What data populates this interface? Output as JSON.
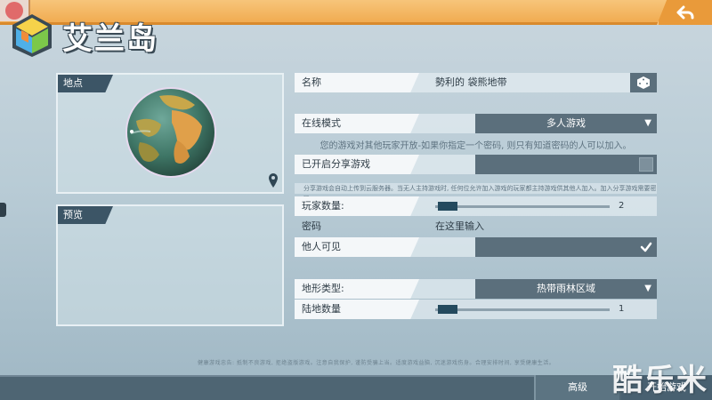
{
  "game": {
    "title": "艾兰岛"
  },
  "panels": {
    "location_label": "地点",
    "preview_label": "预览"
  },
  "settings": {
    "name": {
      "label": "名称",
      "value": "勢利的 袋熊地带"
    },
    "online_mode": {
      "label": "在线模式",
      "value": "多人游戏",
      "description": "您的游戏对其他玩家开放-如果你指定一个密码, 则只有知道密码的人可以加入。"
    },
    "share": {
      "label": "已开启分享游戏",
      "description": "分享游戏会自动上传到云服务器。当无人主持游戏时, 任何位允许加入游戏的玩家都主持游戏供其他人加入。加入分享游戏需要密码。"
    },
    "player_count": {
      "label": "玩家数量:",
      "value": "2",
      "fraction": 0.02
    },
    "password": {
      "label": "密码",
      "placeholder": "在这里输入"
    },
    "visible": {
      "label": "他人可见",
      "checked": true
    },
    "terrain": {
      "label": "地形类型:",
      "value": "热带雨林区域"
    },
    "land_count": {
      "label": "陆地数量",
      "value": "1",
      "fraction": 0.02
    }
  },
  "footer": {
    "advanced_label": "高级",
    "start_label": "开始游戏",
    "footnote": "健康游戏忠告: 抵制不良游戏, 拒绝盗版游戏。注意自我保护, 谨防受骗上当。适度游戏益脑, 沉迷游戏伤身。合理安排时间, 享受健康生活。"
  },
  "watermark": "酷乐米",
  "icons": {
    "back": "back-arrow-icon",
    "dice": "dice-icon",
    "map_pin": "map-pin-icon",
    "check": "check-icon",
    "caret": "caret-down-icon",
    "logo": "logo-cube-icon"
  },
  "colors": {
    "topbar": "#f0a84c",
    "panel_tag": "#3c5566",
    "dropdown": "#5b6f7c",
    "slider_thumb": "#244a5e"
  }
}
